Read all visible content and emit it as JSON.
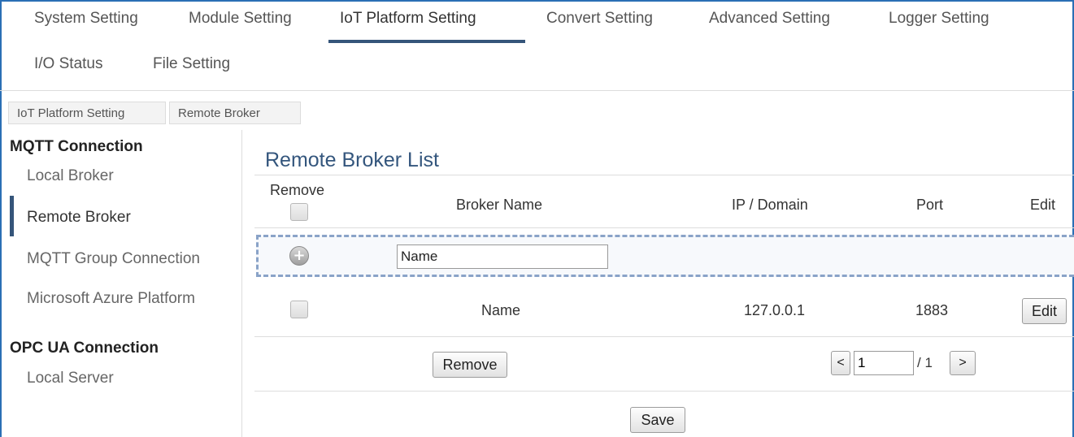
{
  "nav": {
    "tabs": [
      {
        "label": "System Setting"
      },
      {
        "label": "Module Setting"
      },
      {
        "label": "IoT Platform Setting",
        "active": true
      },
      {
        "label": "Convert Setting"
      },
      {
        "label": "Advanced Setting"
      },
      {
        "label": "Logger Setting"
      },
      {
        "label": "I/O Status"
      },
      {
        "label": "File Setting"
      }
    ]
  },
  "breadcrumb": [
    "IoT Platform Setting",
    "Remote Broker"
  ],
  "sidebar": {
    "mqtt_header": "MQTT Connection",
    "mqtt_items": [
      "Local Broker",
      "Remote Broker",
      "MQTT Group Connection",
      "Microsoft Azure Platform"
    ],
    "opcua_header": "OPC UA Connection",
    "opcua_items": [
      "Local Server"
    ],
    "active_item": "Remote Broker"
  },
  "main": {
    "title": "Remote Broker List",
    "columns": {
      "remove": "Remove",
      "broker_name": "Broker Name",
      "ip_domain": "IP / Domain",
      "port": "Port",
      "edit": "Edit"
    },
    "add_row": {
      "name_value": "Name"
    },
    "rows": [
      {
        "name": "Name",
        "ip": "127.0.0.1",
        "port": "1883",
        "edit_label": "Edit"
      }
    ],
    "remove_button": "Remove",
    "pager": {
      "prev": "<",
      "page": "1",
      "total": "/ 1",
      "next": ">"
    },
    "save_button": "Save"
  },
  "colors": {
    "accent": "#35557a",
    "title": "#34567d",
    "frame": "#2a6fb5",
    "dashed_border": "#8aa3c8"
  }
}
